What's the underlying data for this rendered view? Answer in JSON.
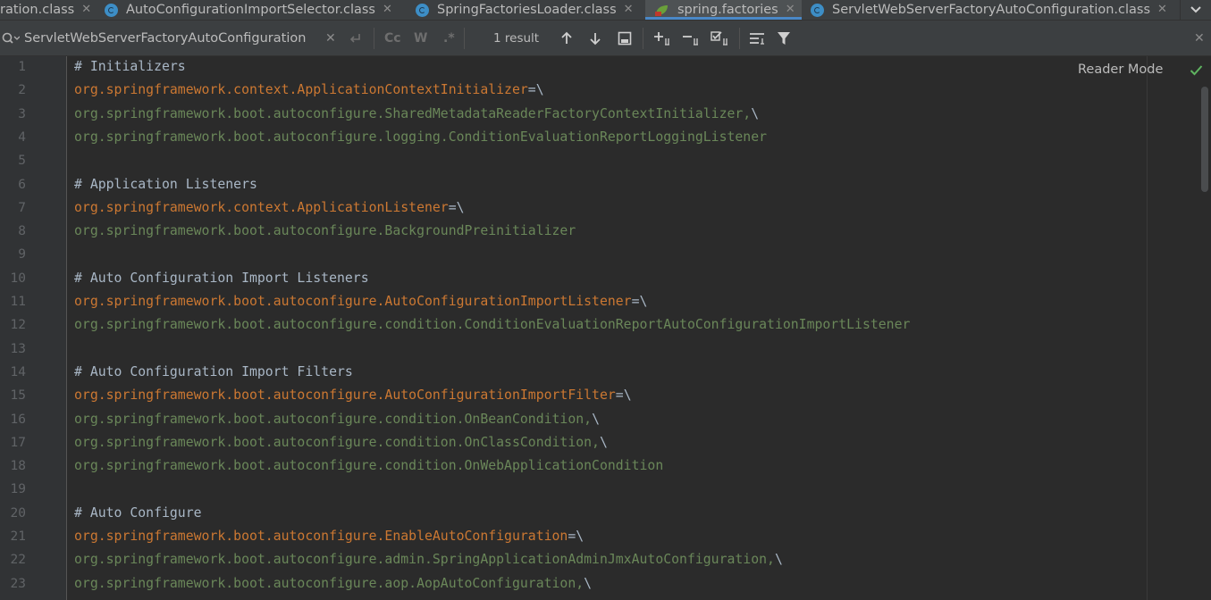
{
  "tabs": [
    {
      "label": "ration.class",
      "icon": "none"
    },
    {
      "label": "AutoConfigurationImportSelector.class",
      "icon": "class-icon"
    },
    {
      "label": "SpringFactoriesLoader.class",
      "icon": "class-icon"
    },
    {
      "label": "spring.factories",
      "icon": "spring-leaf-icon",
      "active": true
    },
    {
      "label": "ServletWebServerFactoryAutoConfiguration.class",
      "icon": "class-icon"
    }
  ],
  "find": {
    "query": "ServletWebServerFactoryAutoConfiguration",
    "match_case_label": "Cc",
    "words_label": "W",
    "regex_label": ".*",
    "result_count": "1 result"
  },
  "editor": {
    "reader_mode_label": "Reader Mode",
    "lines": [
      {
        "n": "1",
        "tokens": [
          {
            "t": "# Initializers",
            "c": "comment"
          }
        ]
      },
      {
        "n": "2",
        "tokens": [
          {
            "t": "org.springframework.context.ApplicationContextInitializer",
            "c": "key"
          },
          {
            "t": "=\\",
            "c": "op"
          }
        ]
      },
      {
        "n": "3",
        "tokens": [
          {
            "t": "org.springframework.boot.autoconfigure.SharedMetadataReaderFactoryContextInitializer,",
            "c": "val"
          },
          {
            "t": "\\",
            "c": "op"
          }
        ]
      },
      {
        "n": "4",
        "tokens": [
          {
            "t": "org.springframework.boot.autoconfigure.logging.ConditionEvaluationReportLoggingListener",
            "c": "val"
          }
        ]
      },
      {
        "n": "5",
        "tokens": []
      },
      {
        "n": "6",
        "tokens": [
          {
            "t": "# Application Listeners",
            "c": "comment"
          }
        ]
      },
      {
        "n": "7",
        "tokens": [
          {
            "t": "org.springframework.context.ApplicationListener",
            "c": "key"
          },
          {
            "t": "=\\",
            "c": "op"
          }
        ]
      },
      {
        "n": "8",
        "tokens": [
          {
            "t": "org.springframework.boot.autoconfigure.BackgroundPreinitializer",
            "c": "val"
          }
        ]
      },
      {
        "n": "9",
        "tokens": []
      },
      {
        "n": "10",
        "tokens": [
          {
            "t": "# Auto Configuration Import Listeners",
            "c": "comment"
          }
        ]
      },
      {
        "n": "11",
        "tokens": [
          {
            "t": "org.springframework.boot.autoconfigure.AutoConfigurationImportListener",
            "c": "key"
          },
          {
            "t": "=\\",
            "c": "op"
          }
        ]
      },
      {
        "n": "12",
        "tokens": [
          {
            "t": "org.springframework.boot.autoconfigure.condition.ConditionEvaluationReportAutoConfigurationImportListener",
            "c": "val"
          }
        ]
      },
      {
        "n": "13",
        "tokens": []
      },
      {
        "n": "14",
        "tokens": [
          {
            "t": "# Auto Configuration Import Filters",
            "c": "comment"
          }
        ]
      },
      {
        "n": "15",
        "tokens": [
          {
            "t": "org.springframework.boot.autoconfigure.AutoConfigurationImportFilter",
            "c": "key"
          },
          {
            "t": "=\\",
            "c": "op"
          }
        ]
      },
      {
        "n": "16",
        "tokens": [
          {
            "t": "org.springframework.boot.autoconfigure.condition.OnBeanCondition,",
            "c": "val"
          },
          {
            "t": "\\",
            "c": "op"
          }
        ]
      },
      {
        "n": "17",
        "tokens": [
          {
            "t": "org.springframework.boot.autoconfigure.condition.OnClassCondition,",
            "c": "val"
          },
          {
            "t": "\\",
            "c": "op"
          }
        ]
      },
      {
        "n": "18",
        "tokens": [
          {
            "t": "org.springframework.boot.autoconfigure.condition.OnWebApplicationCondition",
            "c": "val"
          }
        ]
      },
      {
        "n": "19",
        "tokens": []
      },
      {
        "n": "20",
        "tokens": [
          {
            "t": "# Auto Configure",
            "c": "comment"
          }
        ]
      },
      {
        "n": "21",
        "tokens": [
          {
            "t": "org.springframework.boot.autoconfigure.EnableAutoConfiguration",
            "c": "key"
          },
          {
            "t": "=\\",
            "c": "op"
          }
        ]
      },
      {
        "n": "22",
        "tokens": [
          {
            "t": "org.springframework.boot.autoconfigure.admin.SpringApplicationAdminJmxAutoConfiguration,",
            "c": "val"
          },
          {
            "t": "\\",
            "c": "op"
          }
        ]
      },
      {
        "n": "23",
        "tokens": [
          {
            "t": "org.springframework.boot.autoconfigure.aop.AopAutoConfiguration,",
            "c": "val"
          },
          {
            "t": "\\",
            "c": "op"
          }
        ]
      }
    ]
  }
}
